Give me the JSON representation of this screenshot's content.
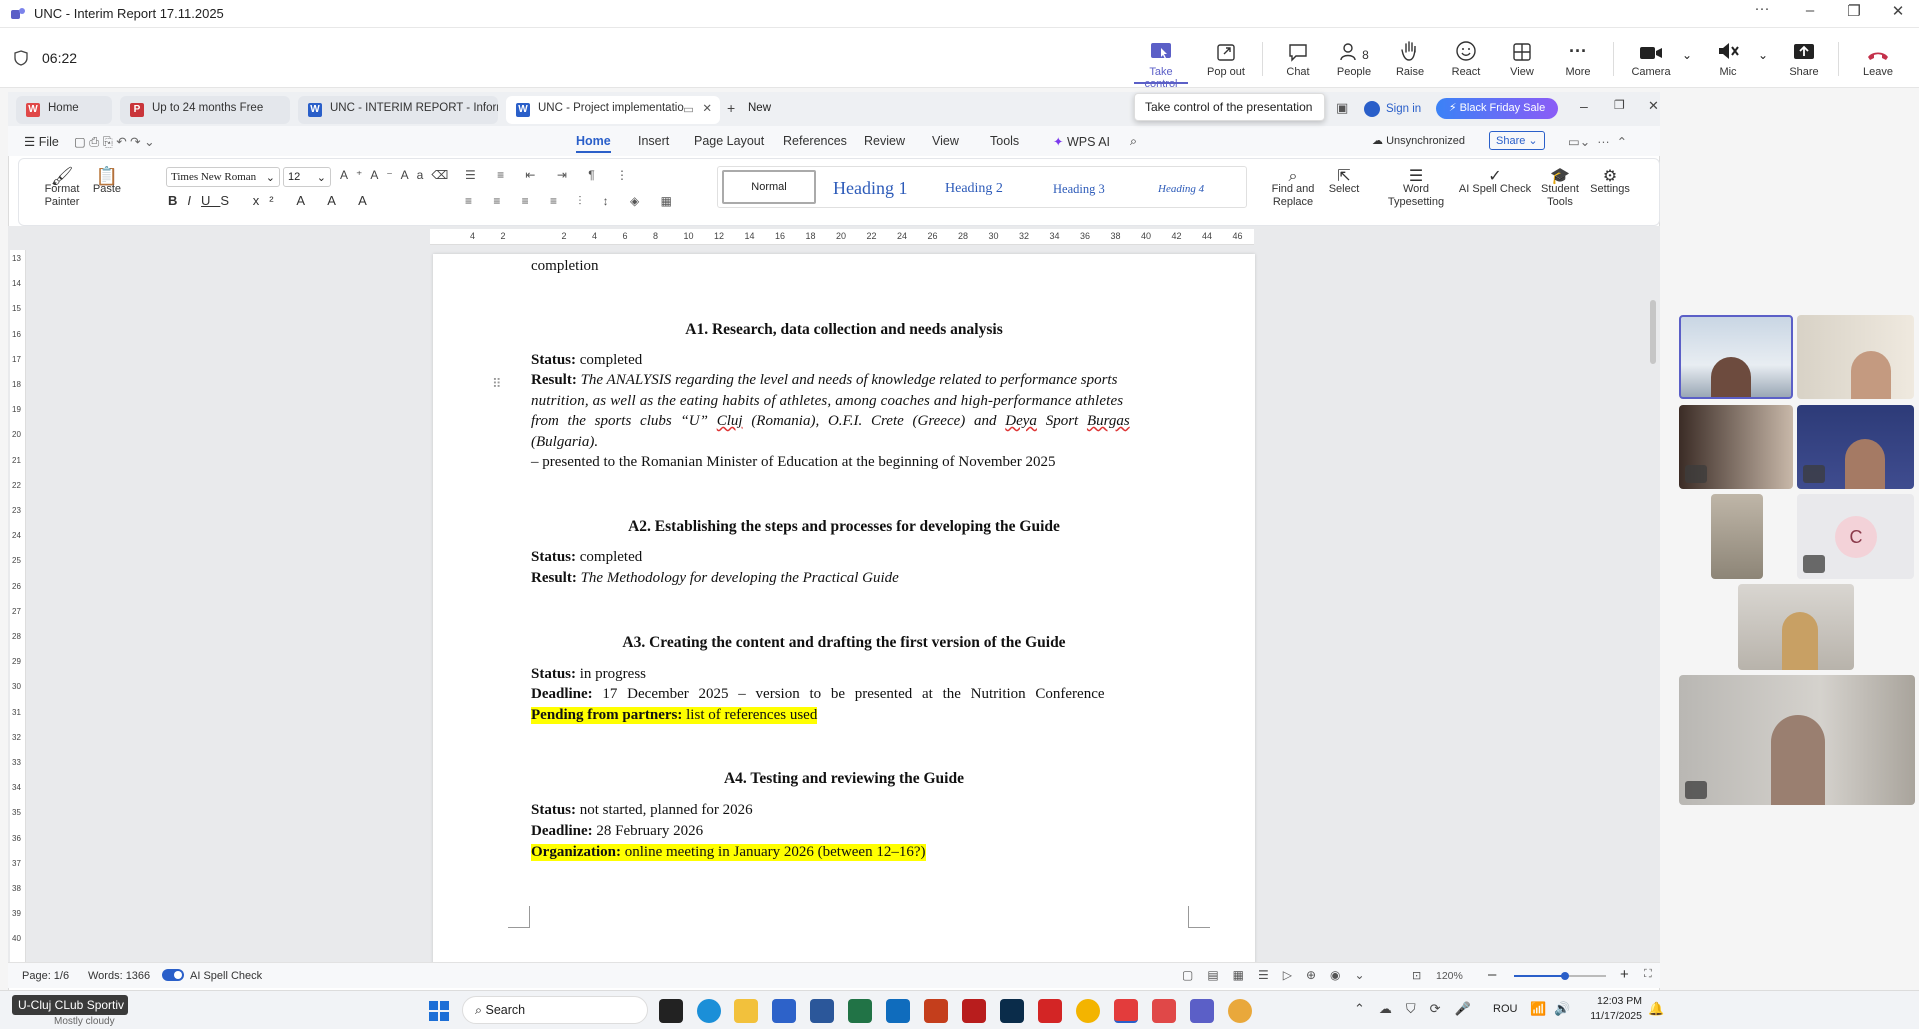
{
  "teams": {
    "title": "UNC - Interim Report 17.11.2025",
    "timer": "06:22",
    "buttons": [
      {
        "label": "Take control",
        "icon": "take-control-icon"
      },
      {
        "label": "Pop out",
        "icon": "pop-out-icon"
      },
      {
        "label": "Chat",
        "icon": "chat-icon"
      },
      {
        "label": "People",
        "icon": "people-icon",
        "count": "8"
      },
      {
        "label": "Raise",
        "icon": "raise-hand-icon"
      },
      {
        "label": "React",
        "icon": "react-icon"
      },
      {
        "label": "View",
        "icon": "view-icon"
      },
      {
        "label": "More",
        "icon": "more-icon"
      },
      {
        "label": "Camera",
        "icon": "camera-icon"
      },
      {
        "label": "Mic",
        "icon": "mic-icon"
      },
      {
        "label": "Share",
        "icon": "share-icon"
      },
      {
        "label": "Leave",
        "icon": "leave-icon"
      }
    ],
    "tooltip": "Take control of the presentation",
    "accent": "#5b5fc7",
    "leave_color": "#c4314b"
  },
  "wps": {
    "tabs": [
      {
        "label": "Home",
        "color": "#e04848"
      },
      {
        "label": "Up to 24 months Free",
        "color": "#c9353a"
      },
      {
        "label": "UNC - INTERIM REPORT - Informatio",
        "color": "#2a5fc9"
      },
      {
        "label": "UNC - Project implementatio",
        "color": "#2a5fc9"
      }
    ],
    "new_tab": "New",
    "sign_in": "Sign in",
    "promo": "Black Friday Sale",
    "menu": [
      "File",
      "Home",
      "Insert",
      "Page Layout",
      "References",
      "Review",
      "View",
      "Tools",
      "WPS AI"
    ],
    "unsync": "Unsynchronized",
    "share": "Share",
    "font": "Times New Roman",
    "size": "12",
    "ribbon_left": [
      "Format Painter",
      "Paste"
    ],
    "styles": [
      "Normal",
      "Heading 1",
      "Heading 2",
      "Heading 3",
      "Heading 4"
    ],
    "ribbon_right": [
      "Find and Replace",
      "Select",
      "Word Typesetting",
      "AI Spell Check",
      "Student Tools",
      "Settings"
    ],
    "ruler": [
      "4",
      "2",
      "",
      "2",
      "4",
      "6",
      "8",
      "10",
      "12",
      "14",
      "16",
      "18",
      "20",
      "22",
      "24",
      "26",
      "28",
      "30",
      "32",
      "34",
      "36",
      "38",
      "40",
      "42",
      "44",
      "46"
    ],
    "vruler": [
      "13",
      "14",
      "15",
      "16",
      "17",
      "18",
      "19",
      "20",
      "21",
      "22",
      "23",
      "24",
      "25",
      "26",
      "27",
      "28",
      "29",
      "30",
      "31",
      "32",
      "33",
      "34",
      "35",
      "36",
      "37",
      "38",
      "39",
      "40"
    ]
  },
  "doc": {
    "top_line": "completion",
    "a1": {
      "title": "A1. Research, data collection and needs analysis",
      "status_label": "Status:",
      "status": " completed",
      "result_label": "Result:",
      "r1": " The ANALYSIS regarding the level and needs of knowledge related to performance sports",
      "r2": "nutrition, as well as the eating habits of athletes, among coaches and high-performance athletes",
      "r3a": "from the sports clubs “U” ",
      "cluj": "Cluj",
      "r3b": " (Romania), O.F.I. Crete (Greece) and ",
      "deya": "Deya",
      "r3c": " Sport ",
      "burgas": "Burgas",
      "r4": "(Bulgaria).",
      "r5": "– presented to the Romanian Minister of Education at the beginning of November 2025"
    },
    "a2": {
      "title": "A2. Establishing the steps and processes for developing the Guide",
      "status_label": "Status:",
      "status": " completed",
      "result_label": "Result:",
      "result": " The Methodology for developing the Practical Guide"
    },
    "a3": {
      "title": "A3. Creating the content and drafting the first version of the Guide",
      "status_label": "Status:",
      "status": " in progress",
      "deadline_label": "Deadline:",
      "deadline": " 17 December 2025 – version to be presented at the Nutrition Conference",
      "pending_label": "Pending from partners:",
      "pending": " list of references used"
    },
    "a4": {
      "title": "A4. Testing and reviewing the Guide",
      "status_label": "Status:",
      "status": " not started, planned for 2026",
      "deadline_label": "Deadline:",
      "deadline": " 28 February 2026",
      "org_label": "Organization:",
      "org": " online meeting in January 2026 (between 12–16?)"
    }
  },
  "statusbar": {
    "page": "Page: 1/6",
    "words": "Words: 1366",
    "spell": "AI Spell Check",
    "zoom": "120%",
    "zoom_level": 0.55
  },
  "taskbar": {
    "search": "Search",
    "presenter": "U-Cluj CLub Sportiv",
    "weather": "Mostly cloudy",
    "lang": "ROU",
    "time": "12:03 PM",
    "date": "11/17/2025"
  },
  "participants": {
    "initial": "C"
  }
}
